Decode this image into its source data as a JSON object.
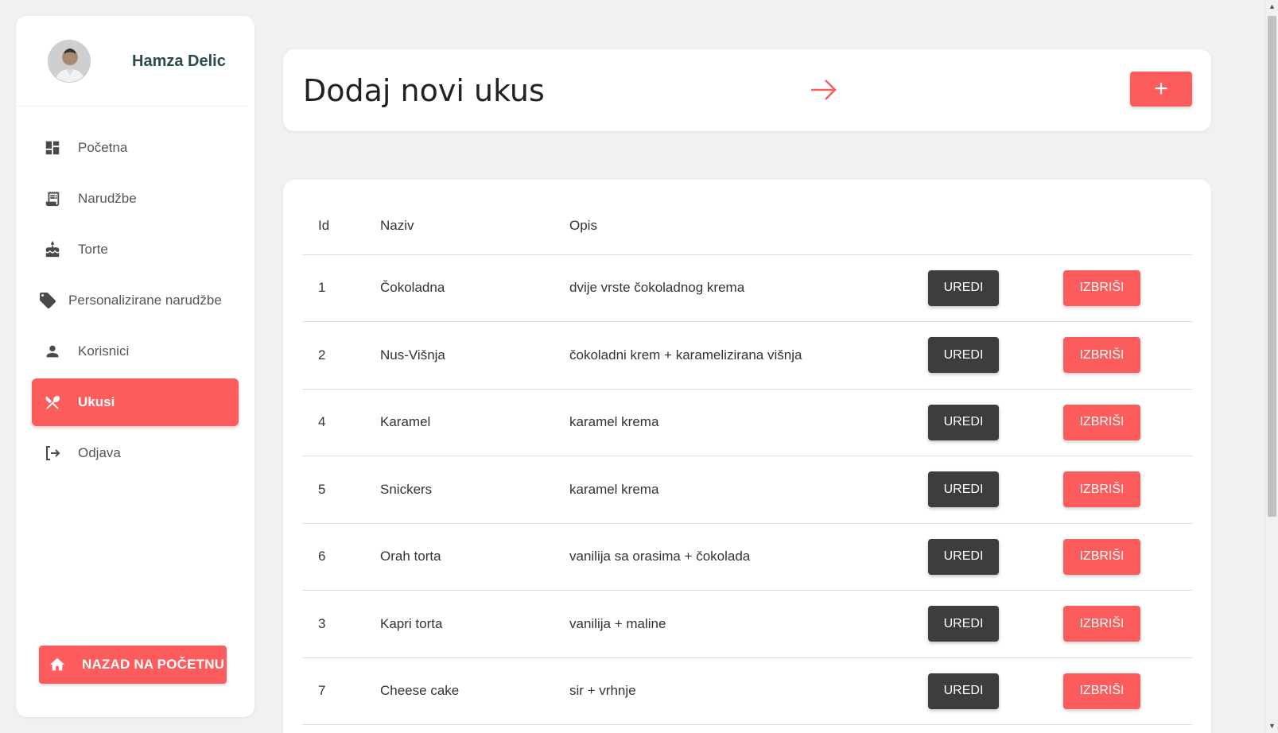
{
  "user": {
    "name": "Hamza Delic"
  },
  "sidebar": {
    "items": [
      {
        "label": "Početna",
        "icon": "dashboard-icon",
        "active": false
      },
      {
        "label": "Narudžbe",
        "icon": "receipt-icon",
        "active": false
      },
      {
        "label": "Torte",
        "icon": "cake-icon",
        "active": false
      },
      {
        "label": "Personalizirane narudžbe",
        "icon": "tag-icon",
        "active": false
      },
      {
        "label": "Korisnici",
        "icon": "person-icon",
        "active": false
      },
      {
        "label": "Ukusi",
        "icon": "utensils-icon",
        "active": true
      },
      {
        "label": "Odjava",
        "icon": "logout-icon",
        "active": false
      }
    ],
    "home_button": "NAZAD NA POČETNU"
  },
  "header": {
    "title": "Dodaj novi ukus",
    "add_button": "+"
  },
  "table": {
    "columns": [
      "Id",
      "Naziv",
      "Opis"
    ],
    "edit_label": "UREDI",
    "delete_label": "IZBRIŠI",
    "rows": [
      {
        "id": "1",
        "naziv": "Čokoladna",
        "opis": "dvije vrste čokoladnog krema"
      },
      {
        "id": "2",
        "naziv": "Nus-Višnja",
        "opis": "čokoladni krem + karamelizirana višnja"
      },
      {
        "id": "4",
        "naziv": "Karamel",
        "opis": "karamel krema"
      },
      {
        "id": "5",
        "naziv": "Snickers",
        "opis": "karamel krema"
      },
      {
        "id": "6",
        "naziv": "Orah torta",
        "opis": "vanilija sa orasima + čokolada"
      },
      {
        "id": "3",
        "naziv": "Kapri torta",
        "opis": "vanilija + maline"
      },
      {
        "id": "7",
        "naziv": "Cheese cake",
        "opis": "sir + vrhnje"
      }
    ]
  },
  "colors": {
    "accent": "#fc5c5c",
    "dark_button": "#3d3d3d",
    "background": "#f0f1f3"
  }
}
